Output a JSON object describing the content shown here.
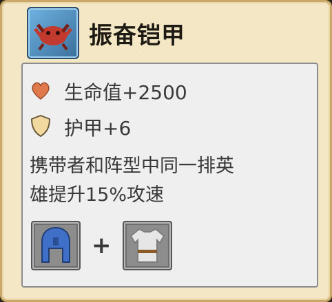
{
  "item": {
    "name": "振奋铠甲",
    "icon": "crab-armor-icon"
  },
  "stats": [
    {
      "icon": "heart-icon",
      "text": "生命值+2500"
    },
    {
      "icon": "shield-icon",
      "text": "护甲+6"
    }
  ],
  "description_lines": [
    "携带者和阵型中同一排英",
    "雄提升15%攻速"
  ],
  "recipe": {
    "components": [
      {
        "icon": "helmet-icon"
      },
      {
        "icon": "cloth-tunic-icon"
      }
    ],
    "operator": "+"
  },
  "colors": {
    "card_bg": "#f4e7c6",
    "panel_bg": "#efefef",
    "heart": "#e07a4c",
    "shield": "#f2d9a0"
  }
}
